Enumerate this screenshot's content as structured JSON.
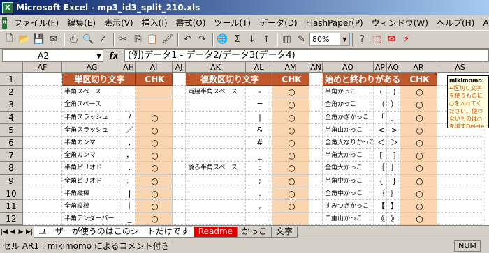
{
  "window": {
    "title": "Microsoft Excel - mp3_id3_split_210.xls"
  },
  "menu": [
    "ファイル(F)",
    "編集(E)",
    "表示(V)",
    "挿入(I)",
    "書式(O)",
    "ツール(T)",
    "データ(D)",
    "FlashPaper(P)",
    "ウィンドウ(W)",
    "ヘルプ(H)",
    "Adobe"
  ],
  "toolbar": {
    "zoom": "80%"
  },
  "formula": {
    "cell": "A2",
    "fx": "fx",
    "content": "(例)データ1 - データ2/データ3(データ4)"
  },
  "columns": [
    "AF",
    "AG",
    "AH",
    "AI",
    "AJ",
    "AK",
    "AL",
    "AM",
    "AN",
    "AO",
    "AP",
    "AQ",
    "AR",
    "AS"
  ],
  "rows": [
    "1",
    "2",
    "3",
    "4",
    "5",
    "6",
    "7",
    "8",
    "9",
    "10",
    "11",
    "12"
  ],
  "sections": {
    "s1": {
      "title": "単区切り文字",
      "chk": "CHK"
    },
    "s2": {
      "title": "複数区切り文字",
      "chk": "CHK"
    },
    "s3": {
      "title": "始めと終わりがある",
      "chk": "CHK"
    }
  },
  "table1": [
    {
      "label": "半角スペース",
      "sym": "",
      "chk": ""
    },
    {
      "label": "全角スペース",
      "sym": "",
      "chk": ""
    },
    {
      "label": "半角スラッシュ",
      "sym": "/",
      "chk": "○"
    },
    {
      "label": "全角スラッシュ",
      "sym": "／",
      "chk": "○"
    },
    {
      "label": "半角カンマ",
      "sym": ",",
      "chk": "○"
    },
    {
      "label": "全角カンマ",
      "sym": "，",
      "chk": "○"
    },
    {
      "label": "半角ピリオド",
      "sym": ".",
      "chk": "○"
    },
    {
      "label": "全角ピリオド",
      "sym": "．",
      "chk": "○"
    },
    {
      "label": "半角縦棒",
      "sym": "|",
      "chk": "○"
    },
    {
      "label": "全角縦棒",
      "sym": "｜",
      "chk": "○"
    },
    {
      "label": "半角アンダーバー",
      "sym": "_",
      "chk": "○"
    }
  ],
  "table2": [
    {
      "label": "両脇半角スペース",
      "sym": "-",
      "chk": "○"
    },
    {
      "label": "",
      "sym": "=",
      "chk": "○"
    },
    {
      "label": "",
      "sym": "|",
      "chk": "○"
    },
    {
      "label": "",
      "sym": "&",
      "chk": "○"
    },
    {
      "label": "",
      "sym": "#",
      "chk": "○"
    },
    {
      "label": "",
      "sym": "_",
      "chk": "○"
    },
    {
      "label": "後ろ半角スペース",
      "sym": ":",
      "chk": "○"
    },
    {
      "label": "",
      "sym": ";",
      "chk": "○"
    },
    {
      "label": "",
      "sym": ".",
      "chk": "○"
    },
    {
      "label": "",
      "sym": ",",
      "chk": "○"
    },
    {
      "label": "",
      "sym": "",
      "chk": ""
    }
  ],
  "table3": [
    {
      "label": "半角かっこ",
      "open": "(",
      "close": ")",
      "chk": "○"
    },
    {
      "label": "全角かっこ",
      "open": "（",
      "close": "）",
      "chk": "○"
    },
    {
      "label": "全角かぎかっこ",
      "open": "「",
      "close": "」",
      "chk": "○"
    },
    {
      "label": "半角山かっこ",
      "open": "<",
      "close": ">",
      "chk": "○"
    },
    {
      "label": "全角大なりかっこ",
      "open": "＜",
      "close": "＞",
      "chk": "○"
    },
    {
      "label": "半角大かっこ",
      "open": "[",
      "close": "]",
      "chk": "○"
    },
    {
      "label": "全角大かっこ",
      "open": "［",
      "close": "］",
      "chk": "○"
    },
    {
      "label": "半角中かっこ",
      "open": "{",
      "close": "}",
      "chk": "○"
    },
    {
      "label": "全角中かっこ",
      "open": "｛",
      "close": "｝",
      "chk": "○"
    },
    {
      "label": "すみつきかっこ",
      "open": "【",
      "close": "】",
      "chk": "○"
    },
    {
      "label": "二重山かっこ",
      "open": "《",
      "close": "》",
      "chk": "○"
    }
  ],
  "comment": {
    "author": "mikimomo:",
    "text": "←区切り文字を使うものに○を入れてください。使わないものは○を消すDeleteしてください。"
  },
  "tabs": [
    "ユーザーが使うのはこのシートだけです",
    "Readme",
    "かっこ",
    "文字"
  ],
  "status": {
    "text": "セル AR1 : mikimomo によるコメント付き",
    "num": "NUM"
  }
}
